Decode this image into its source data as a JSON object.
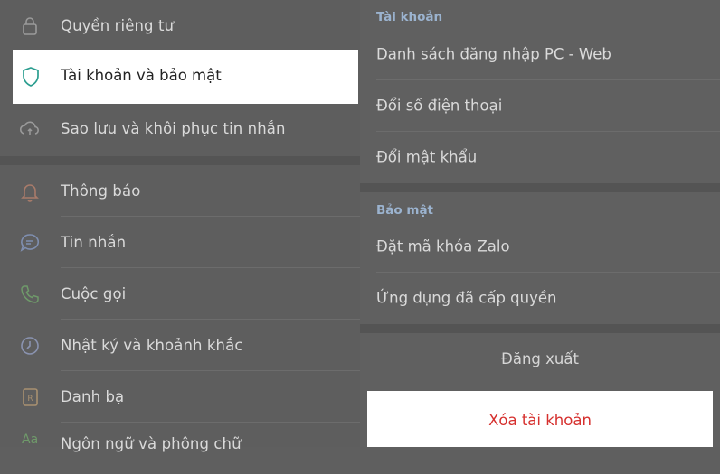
{
  "left_menu": {
    "items": [
      {
        "label": "Quyền riêng tư",
        "icon": "lock-icon"
      },
      {
        "label": "Tài khoản và bảo mật",
        "icon": "shield-icon",
        "selected": true
      },
      {
        "label": "Sao lưu và khôi phục tin nhắn",
        "icon": "cloud-sync-icon"
      },
      {
        "label": "Thông báo",
        "icon": "bell-icon"
      },
      {
        "label": "Tin nhắn",
        "icon": "chat-bubble-icon"
      },
      {
        "label": "Cuộc gọi",
        "icon": "phone-icon"
      },
      {
        "label": "Nhật ký và khoảnh khắc",
        "icon": "clock-icon"
      },
      {
        "label": "Danh bạ",
        "icon": "contacts-icon"
      },
      {
        "label": "Ngôn ngữ và phông chữ",
        "icon": "font-icon"
      }
    ]
  },
  "right_panel": {
    "account_section": {
      "title": "Tài khoản",
      "items": [
        "Danh sách đăng nhập PC - Web",
        "Đổi số điện thoại",
        "Đổi mật khẩu"
      ]
    },
    "security_section": {
      "title": "Bảo mật",
      "items": [
        "Đặt mã khóa Zalo",
        "Ứng dụng đã cấp quyền"
      ]
    },
    "logout_label": "Đăng xuất",
    "delete_account_label": "Xóa tài khoản"
  },
  "colors": {
    "accent_teal": "#2a9d8f",
    "danger_red": "#d6302e",
    "section_blue": "#9bb3cf",
    "dim_overlay": "#5f5f5f"
  }
}
